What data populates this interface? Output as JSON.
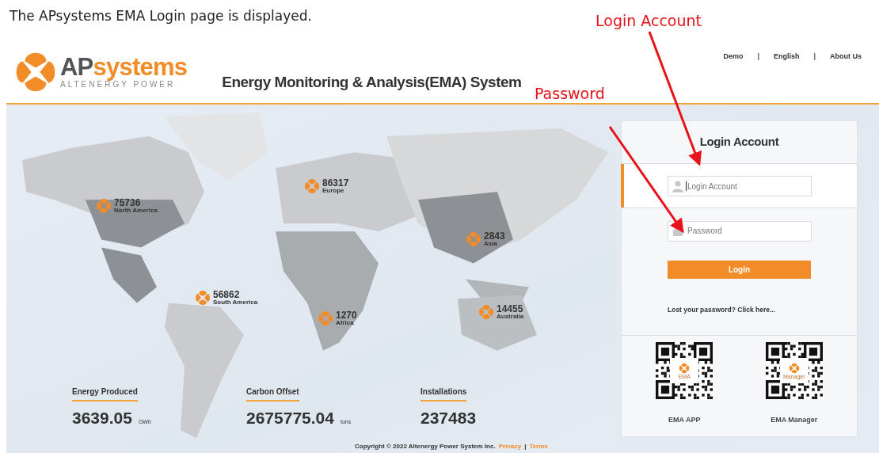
{
  "caption": "The APsystems EMA Login page is displayed.",
  "annotations": [
    {
      "label": "Login Account"
    },
    {
      "label": "Password"
    }
  ],
  "header": {
    "logo": {
      "brand_prefix": "AP",
      "brand_suffix": "systems",
      "tagline": "ALTENERGY POWER"
    },
    "title": "Energy Monitoring & Analysis(EMA) System",
    "links": [
      "Demo",
      "English",
      "About Us"
    ],
    "separator": "|"
  },
  "map_markers": [
    {
      "count": "75736",
      "region": "North America"
    },
    {
      "count": "86317",
      "region": "Europe"
    },
    {
      "count": "56862",
      "region": "South America"
    },
    {
      "count": "1270",
      "region": "Africa"
    },
    {
      "count": "2843",
      "region": "Asia"
    },
    {
      "count": "14455",
      "region": "Australia"
    }
  ],
  "stats": [
    {
      "label": "Energy Produced",
      "value": "3639.05",
      "unit": "GWh"
    },
    {
      "label": "Carbon Offset",
      "value": "2675775.04",
      "unit": "tons"
    },
    {
      "label": "Installations",
      "value": "237483"
    }
  ],
  "login": {
    "title": "Login Account",
    "fields": [
      {
        "kind": "account",
        "placeholder": "Login Account",
        "focused": true
      },
      {
        "kind": "password",
        "placeholder": "Password",
        "focused": false
      }
    ],
    "button": "Login",
    "forgot_link": "Lost your password? Click here...",
    "apps": [
      {
        "label": "EMA APP",
        "badge": "EMA"
      },
      {
        "label": "EMA Manager",
        "badge": "Manager"
      }
    ]
  },
  "footer": {
    "copyright": "Copyright © 2022 Altenergy Power System Inc.",
    "links": [
      "Privacy",
      "Terms"
    ],
    "separator": "|"
  }
}
